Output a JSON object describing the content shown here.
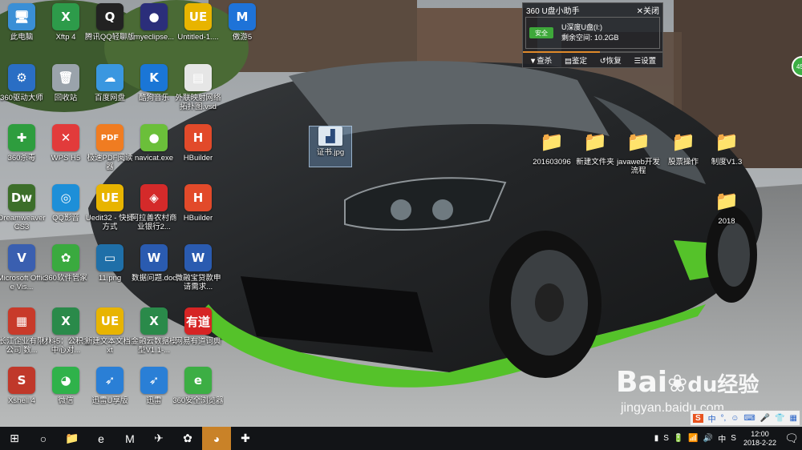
{
  "desktop": {
    "icons": [
      {
        "label": "此电脑",
        "glyph": "🖥",
        "color": "#3a8fd6"
      },
      {
        "label": "Xftp 4",
        "glyph": "X",
        "color": "#2d9b4a"
      },
      {
        "label": "腾讯QQ轻聊版",
        "glyph": "Q",
        "color": "#222222"
      },
      {
        "label": "myeclipse...",
        "glyph": "●",
        "color": "#2b2e7a"
      },
      {
        "label": "Untitled-1....",
        "glyph": "UE",
        "color": "#e8b400"
      },
      {
        "label": "傲游5",
        "glyph": "M",
        "color": "#1e73d8"
      },
      {
        "label": "360驱动大师",
        "glyph": "⚙",
        "color": "#2a6ec4"
      },
      {
        "label": "回收站",
        "glyph": "🗑",
        "color": "#9aa3ab"
      },
      {
        "label": "百度网盘",
        "glyph": "☁",
        "color": "#3a97e0"
      },
      {
        "label": "酷狗音乐",
        "glyph": "K",
        "color": "#1a76d6"
      },
      {
        "label": "外联映射网络拓扑图.vsd",
        "glyph": "▤",
        "color": "#e6e6e6"
      },
      {
        "label": "360杀毒",
        "glyph": "✚",
        "color": "#2e9d3e"
      },
      {
        "label": "WPS H5",
        "glyph": "✕",
        "color": "#e23b3b"
      },
      {
        "label": "极速PDF阅读器",
        "glyph": "PDF",
        "color": "#f07c21"
      },
      {
        "label": "navicat.exe",
        "glyph": "●",
        "color": "#6bbf3a"
      },
      {
        "label": "HBuilder",
        "glyph": "H",
        "color": "#e24a2a"
      },
      {
        "label": "Dreamweaver CS3",
        "glyph": "Dw",
        "color": "#3c6e2a"
      },
      {
        "label": "QQ影音",
        "glyph": "◎",
        "color": "#1d8fd8"
      },
      {
        "label": "Uedit32 - 快捷方式",
        "glyph": "UE",
        "color": "#e8b400"
      },
      {
        "label": "阿拉善农村商业银行2...",
        "glyph": "◈",
        "color": "#d42a2a"
      },
      {
        "label": "HBuilder",
        "glyph": "H",
        "color": "#e24a2a"
      },
      {
        "label": "Microsoft Office Vis...",
        "glyph": "V",
        "color": "#3a5fb0"
      },
      {
        "label": "360软件管家",
        "glyph": "✿",
        "color": "#3aaa3f"
      },
      {
        "label": "11.png",
        "glyph": "▭",
        "color": "#1f6fa8"
      },
      {
        "label": "数据问题.doc",
        "glyph": "W",
        "color": "#2a5bb0"
      },
      {
        "label": "微融宝贷款申请需求...",
        "glyph": "W",
        "color": "#2a5bb0"
      },
      {
        "label": "长江企业有限公司 数...",
        "glyph": "▦",
        "color": "#c83a2a"
      },
      {
        "label": "材料5：公积金中心对...",
        "glyph": "X",
        "color": "#2a8a4a"
      },
      {
        "label": "新建文本文档.txt",
        "glyph": "UE",
        "color": "#e8b400"
      },
      {
        "label": "金融云数据模型V1.1-...",
        "glyph": "X",
        "color": "#2a8a4a"
      },
      {
        "label": "网易有道词典",
        "glyph": "有道",
        "color": "#d62424"
      },
      {
        "label": "Xshell 4",
        "glyph": "S",
        "color": "#c0382a"
      },
      {
        "label": "微信",
        "glyph": "◕",
        "color": "#2fb24a"
      },
      {
        "label": "迅雷U享版",
        "glyph": "➶",
        "color": "#2a7fd6"
      },
      {
        "label": "迅雷",
        "glyph": "➶",
        "color": "#2a7fd6"
      },
      {
        "label": "360安全浏览器",
        "glyph": "e",
        "color": "#3cae44"
      }
    ],
    "right_icons": [
      {
        "label": "201603096",
        "glyph": "📁"
      },
      {
        "label": "新建文件夹",
        "glyph": "📁"
      },
      {
        "label": "javaweb开发流程",
        "glyph": "📁"
      },
      {
        "label": "股票操作",
        "glyph": "📁"
      },
      {
        "label": "制度V1.3",
        "glyph": "📁"
      },
      {
        "label": "2018",
        "glyph": "📁"
      }
    ],
    "selected_icon": {
      "label": "证书.jpg",
      "glyph": "▟"
    }
  },
  "widget": {
    "title": "360 U盘小助手",
    "close_label": "关闭",
    "safe_badge": "安全",
    "drive_name": "U深度U盘(I:)",
    "free_space": "剩余空间: 10.2GB",
    "usage_fraction": 0.55,
    "actions": [
      "查杀",
      "鉴定",
      "恢复",
      "设置"
    ]
  },
  "side_badge": "45",
  "watermark": {
    "brand": "Bai",
    "paw": "du",
    "cn": "经验",
    "url": "jingyan.baidu.com"
  },
  "ime": {
    "items": [
      "S",
      "中",
      "°,",
      "☺",
      "⌨",
      "🎤",
      "👕",
      "▦"
    ]
  },
  "taskbar": {
    "buttons": [
      "⊞",
      "○",
      "📁",
      "e",
      "M",
      "✈",
      "✿",
      "◕",
      "✚"
    ],
    "active_index": 7,
    "tray": {
      "icons": [
        "▮",
        "S",
        "🔋",
        "📶",
        "🔊",
        "中",
        "S"
      ],
      "time": "12:00",
      "date": "2018-2-22",
      "notify": "🗨"
    }
  }
}
